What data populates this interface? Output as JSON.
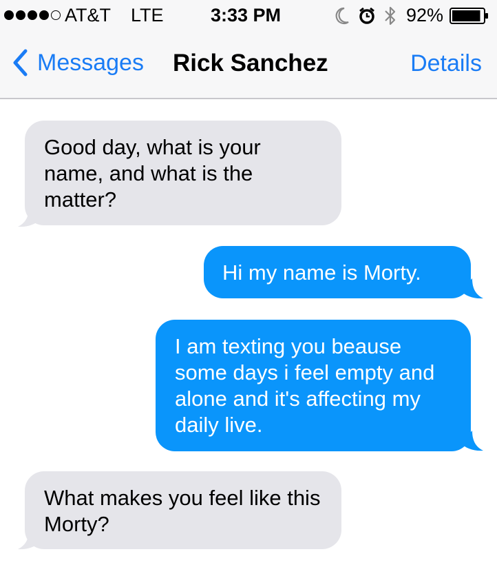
{
  "status_bar": {
    "signal": "●●●●○",
    "carrier": "AT&T",
    "network": "LTE",
    "time": "3:33 PM",
    "battery_percent": "92%",
    "battery_level": 0.92,
    "icons": [
      "moon-icon",
      "alarm-icon",
      "bluetooth-icon",
      "battery-icon"
    ]
  },
  "nav": {
    "back_label": "Messages",
    "title": "Rick Sanchez",
    "details_label": "Details"
  },
  "messages": [
    {
      "direction": "incoming",
      "text": "Good day, what is your name, and what is the matter?"
    },
    {
      "direction": "outgoing",
      "text": "Hi my name is Morty."
    },
    {
      "direction": "outgoing",
      "text": "I am texting you beause some days i feel empty and alone and it's affecting my daily live."
    },
    {
      "direction": "incoming",
      "text": "What makes you feel like this Morty?"
    }
  ],
  "colors": {
    "accent": "#1a7cf5",
    "outgoing_bubble": "#0a95fb",
    "incoming_bubble": "#e5e5ea"
  }
}
